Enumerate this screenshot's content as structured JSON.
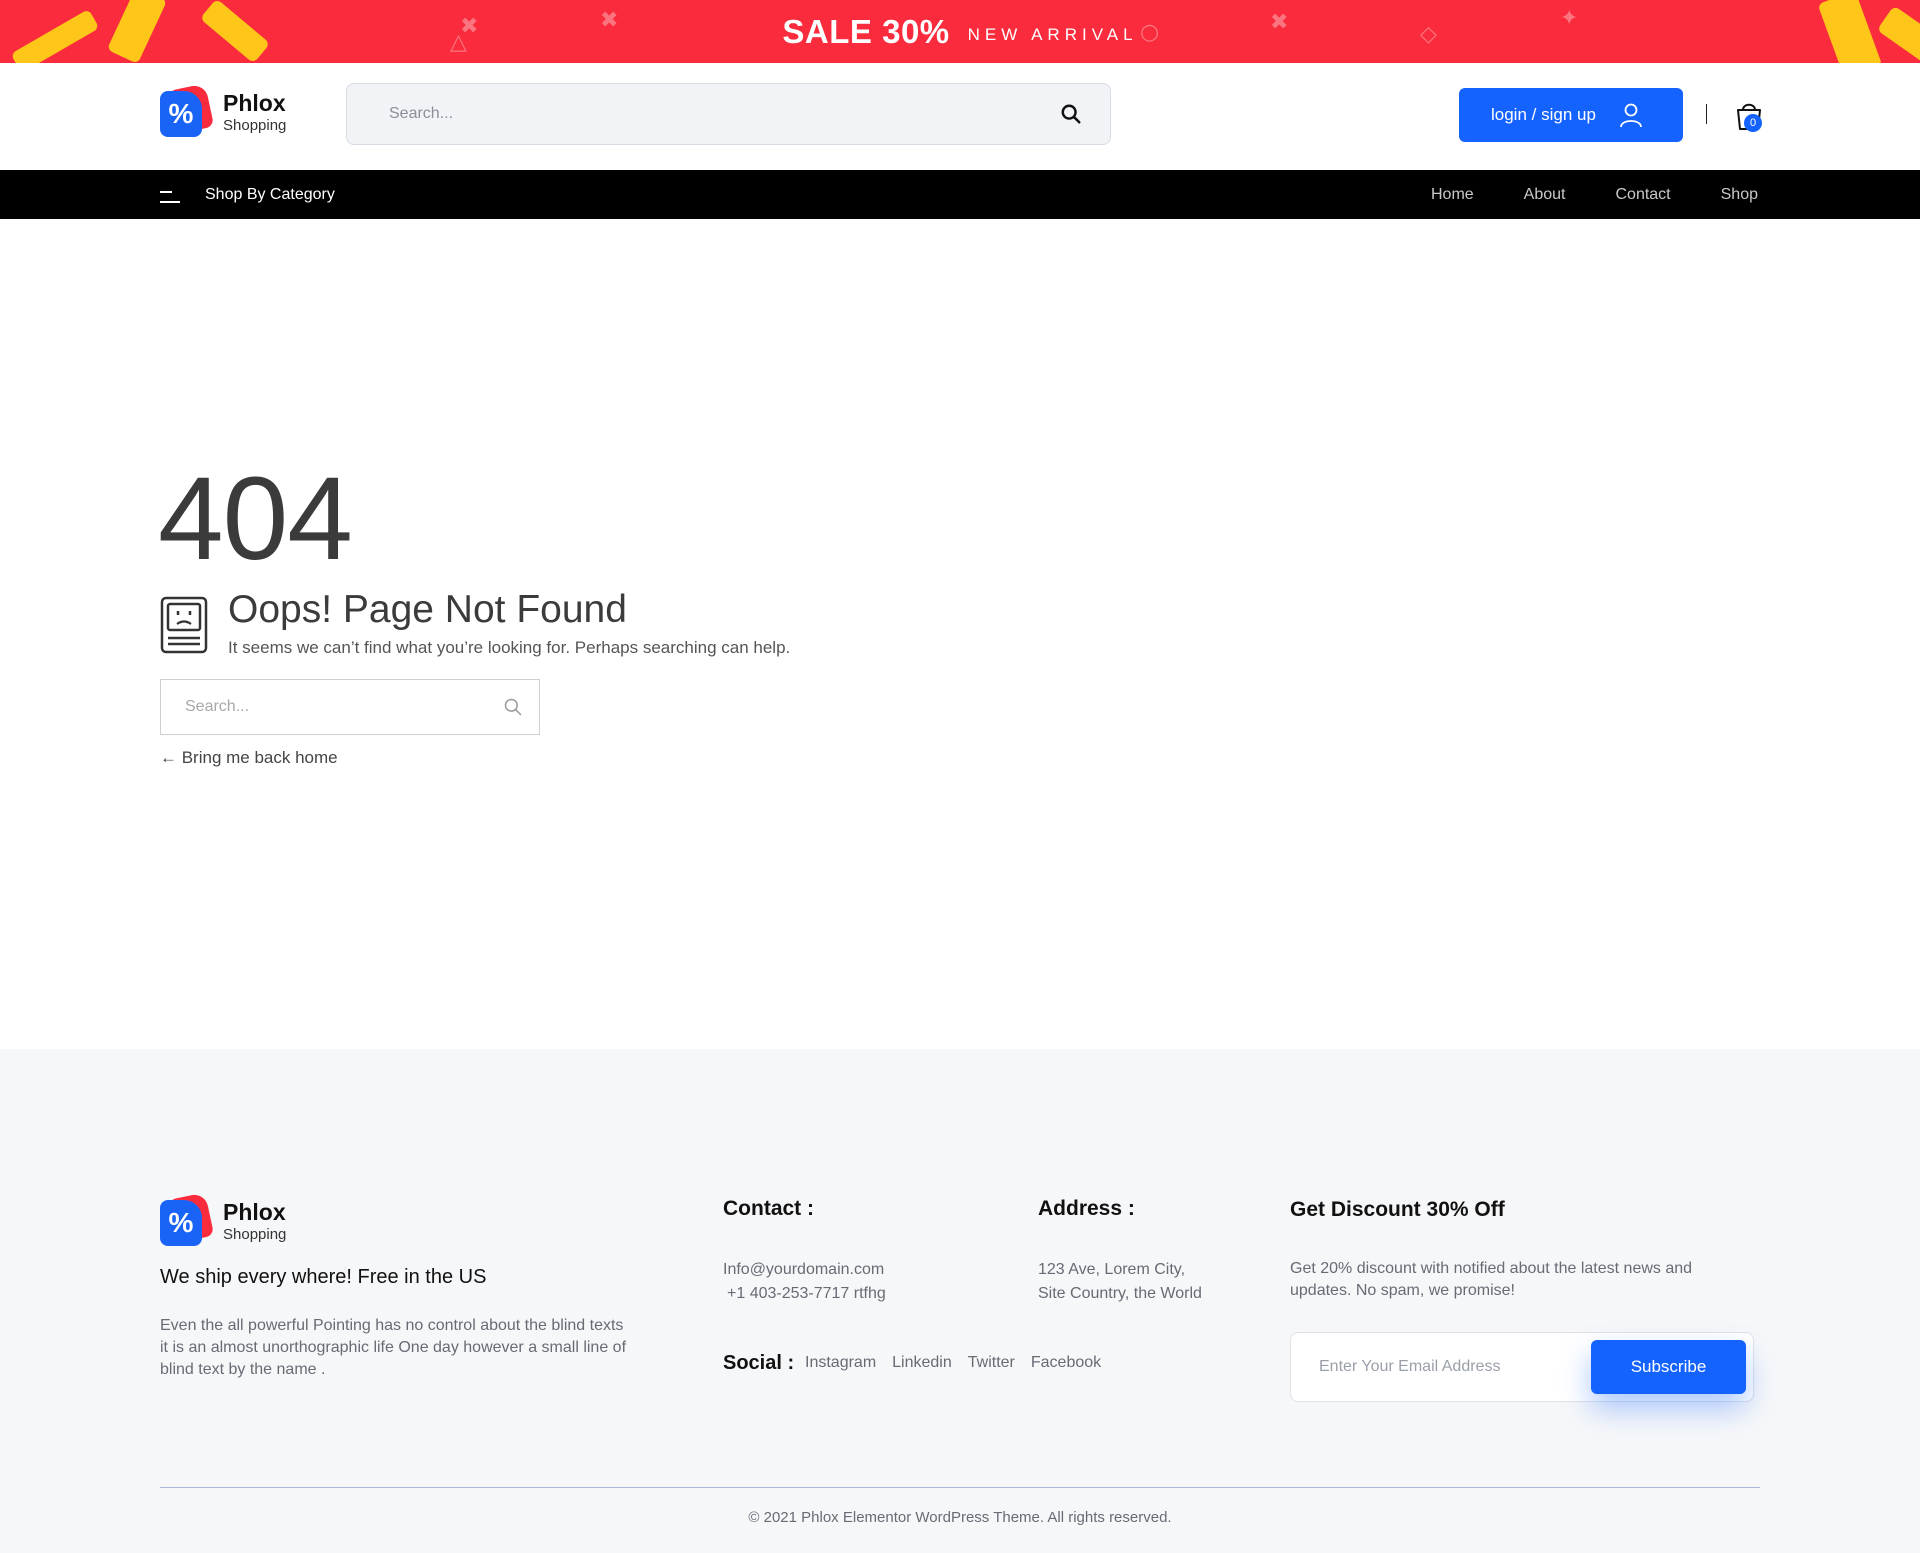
{
  "promo": {
    "title": "SALE 30%",
    "subtitle": "NEW ARRIVAL"
  },
  "brand": {
    "name": "Phlox",
    "tagline": "Shopping",
    "mark_glyph": "%"
  },
  "header": {
    "search_placeholder": "Search...",
    "login_label": "login / sign up",
    "cart_count": "0"
  },
  "nav": {
    "category_label": "Shop By Category",
    "links": [
      "Home",
      "About",
      "Contact",
      "Shop"
    ]
  },
  "error": {
    "code": "404",
    "title": "Oops! Page Not Found",
    "message": "It seems we can’t find what you’re looking for. Perhaps searching can help.",
    "search_placeholder": "Search...",
    "back_link": "← Bring me back home"
  },
  "footer": {
    "ship_title": "We ship every where! Free in the US",
    "description": "Even the all powerful Pointing has no control about the blind texts it is an almost unorthographic life One day however a small line of blind text by the name .",
    "contact": {
      "heading": "Contact :",
      "email": "Info@yourdomain.com",
      "phone": "+1 403-253-7717 rtfhg"
    },
    "address": {
      "heading": "Address :",
      "line1": "123 Ave, Lorem City,",
      "line2": "Site Country, the World"
    },
    "social": {
      "label": "Social :",
      "links": [
        "Instagram",
        "Linkedin",
        "Twitter",
        "Facebook"
      ]
    },
    "discount": {
      "heading": "Get Discount 30% Off",
      "text": "Get 20% discount with notified about the latest news and updates. No spam, we promise!",
      "email_placeholder": "Enter Your Email Address",
      "button": "Subscribe"
    },
    "copyright": "© 2021 Phlox Elementor WordPress Theme. All rights reserved."
  },
  "colors": {
    "promo_red": "#f92b3c",
    "brand_blue": "#1563ff",
    "ribbon_yellow": "#ffc61a",
    "nav_black": "#000000",
    "footer_bg": "#f6f7f9"
  },
  "icons": [
    "search-icon",
    "user-icon",
    "cart-icon",
    "hamburger-icon",
    "sad-computer-icon"
  ]
}
